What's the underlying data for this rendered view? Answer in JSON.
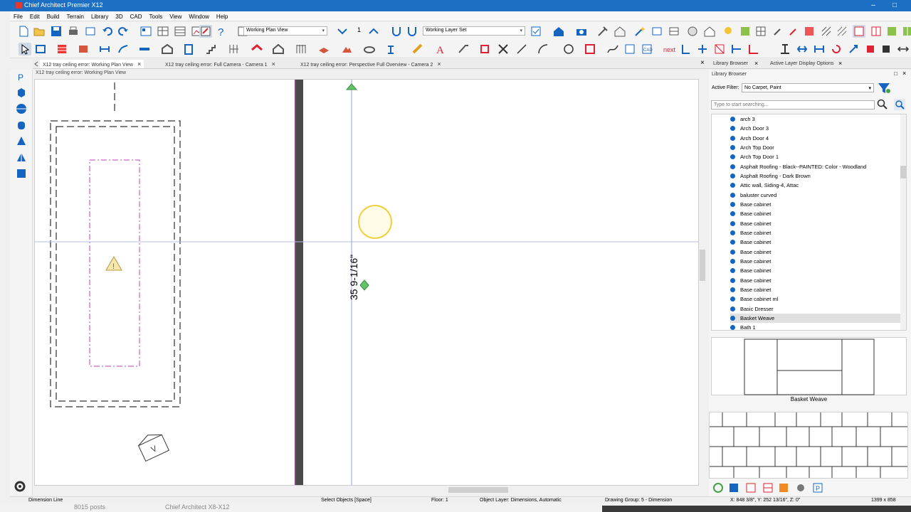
{
  "app": {
    "title": "Chief Architect Premier X12"
  },
  "window_controls": {
    "minimize": "–",
    "maximize": "□",
    "close": "✕"
  },
  "menu": [
    "File",
    "Edit",
    "Build",
    "Terrain",
    "Library",
    "3D",
    "CAD",
    "Tools",
    "View",
    "Window",
    "Help"
  ],
  "toolbar": {
    "view_dropdown": "Working Plan View",
    "layer_dropdown": "Working Layer Set",
    "floor_number": "1",
    "next_label": "next"
  },
  "tabs": [
    {
      "label": "X12 tray ceiling error: Working Plan View"
    },
    {
      "label": "X12 tray ceiling error: Full Camera - Camera 1"
    },
    {
      "label": "X12 tray ceiling error: Perspective Full Overview - Camera 2"
    }
  ],
  "view_title": "X12 tray ceiling error: Working Plan View",
  "canvas": {
    "dimension_label": "35 9-1/16\"",
    "north_label": "V"
  },
  "library": {
    "tabs": [
      "Library Browser",
      "Active Layer Display Options"
    ],
    "panel_title": "Library Browser",
    "filter_label": "Active Filter:",
    "filter_value": "No Carpet, Paint",
    "search_placeholder": "Type to start searching...",
    "items": [
      "arch 3",
      "Arch Door 3",
      "Arch Door 4",
      "Arch Top Door",
      "Arch Top Door 1",
      "Asphalt Roofing - Black--PAINTED: Color - Woodland",
      "Asphalt Roofing - Dark Brown",
      "Attic wall, Siding-4, Attac",
      "baluster curved",
      "Base cabinet",
      "Base cabinet",
      "Base cabinet",
      "Base cabinet",
      "Base cabinet",
      "Base cabinet",
      "Base cabinet",
      "Base cabinet",
      "Base cabinet",
      "Base cabinet",
      "Base cabinet ml",
      "Basic Dresser",
      "Basket Weave",
      "Bath 1"
    ],
    "selected_index": 21,
    "preview_name": "Basket Weave"
  },
  "status": {
    "left": "Dimension Line",
    "mode": "Select Objects [Space]",
    "floor": "Floor: 1",
    "layer": "Object Layer: Dimensions,  Automatic",
    "group": "Drawing Group: 5 - Dimension",
    "coords": "X: 848 3/8\", Y: 252 13/16\", Z: 0\"",
    "size": "1399 x 858"
  },
  "background_text": {
    "posts": "8015 posts",
    "caption": "Chief Architect X8-X12"
  },
  "colors": {
    "titlebar": "#1d6fc4",
    "accent_blue": "#1565c0",
    "magenta": "#c040c0",
    "cursor_yellow": "#f0d040"
  }
}
